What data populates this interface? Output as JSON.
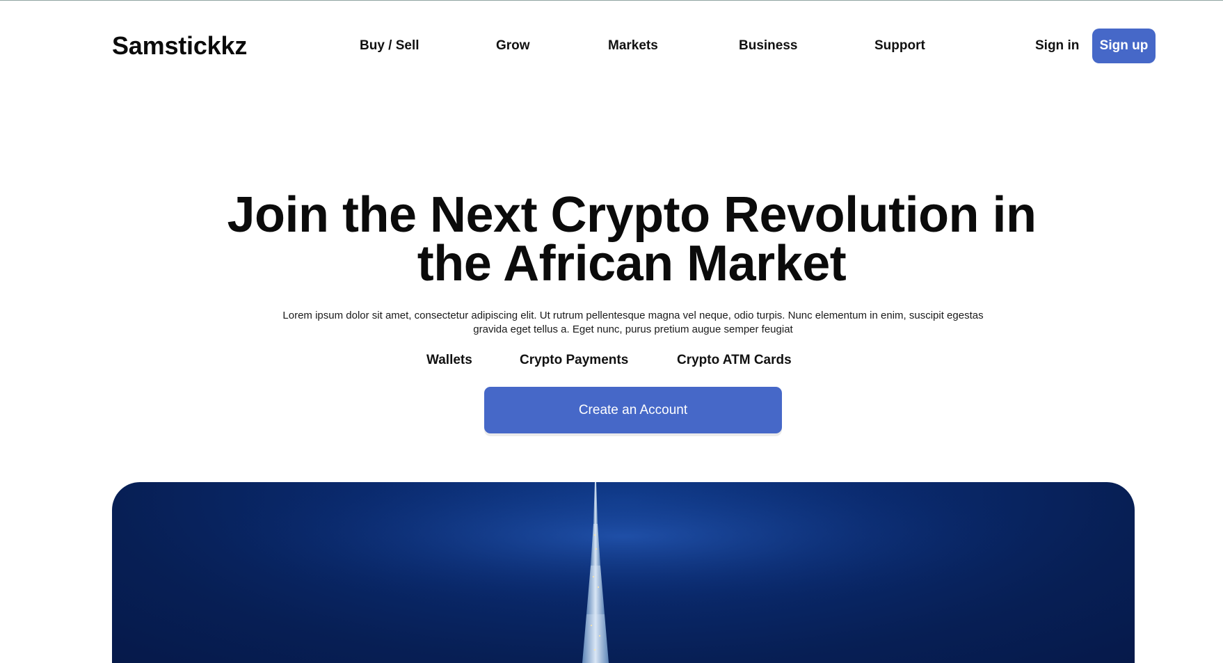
{
  "brand": {
    "name": "Samstickkz"
  },
  "nav": {
    "links": [
      "Buy / Sell",
      "Grow",
      "Markets",
      "Business",
      "Support"
    ],
    "signin_label": "Sign in",
    "signup_label": "Sign up"
  },
  "hero": {
    "title_line1": "Join the Next Crypto Revolution in",
    "title_line2": "the African Market",
    "subtitle": "Lorem ipsum dolor sit amet, consectetur adipiscing elit. Ut rutrum pellentesque magna vel neque, odio turpis. Nunc elementum in enim, suscipit egestas gravida eget tellus a. Eget nunc, purus pretium augue semper feugiat",
    "features": [
      "Wallets",
      "Crypto Payments",
      "Crypto ATM Cards"
    ],
    "cta_label": "Create an Account"
  },
  "colors": {
    "accent": "#4668c8",
    "image_sky": "#0a2a6e"
  }
}
